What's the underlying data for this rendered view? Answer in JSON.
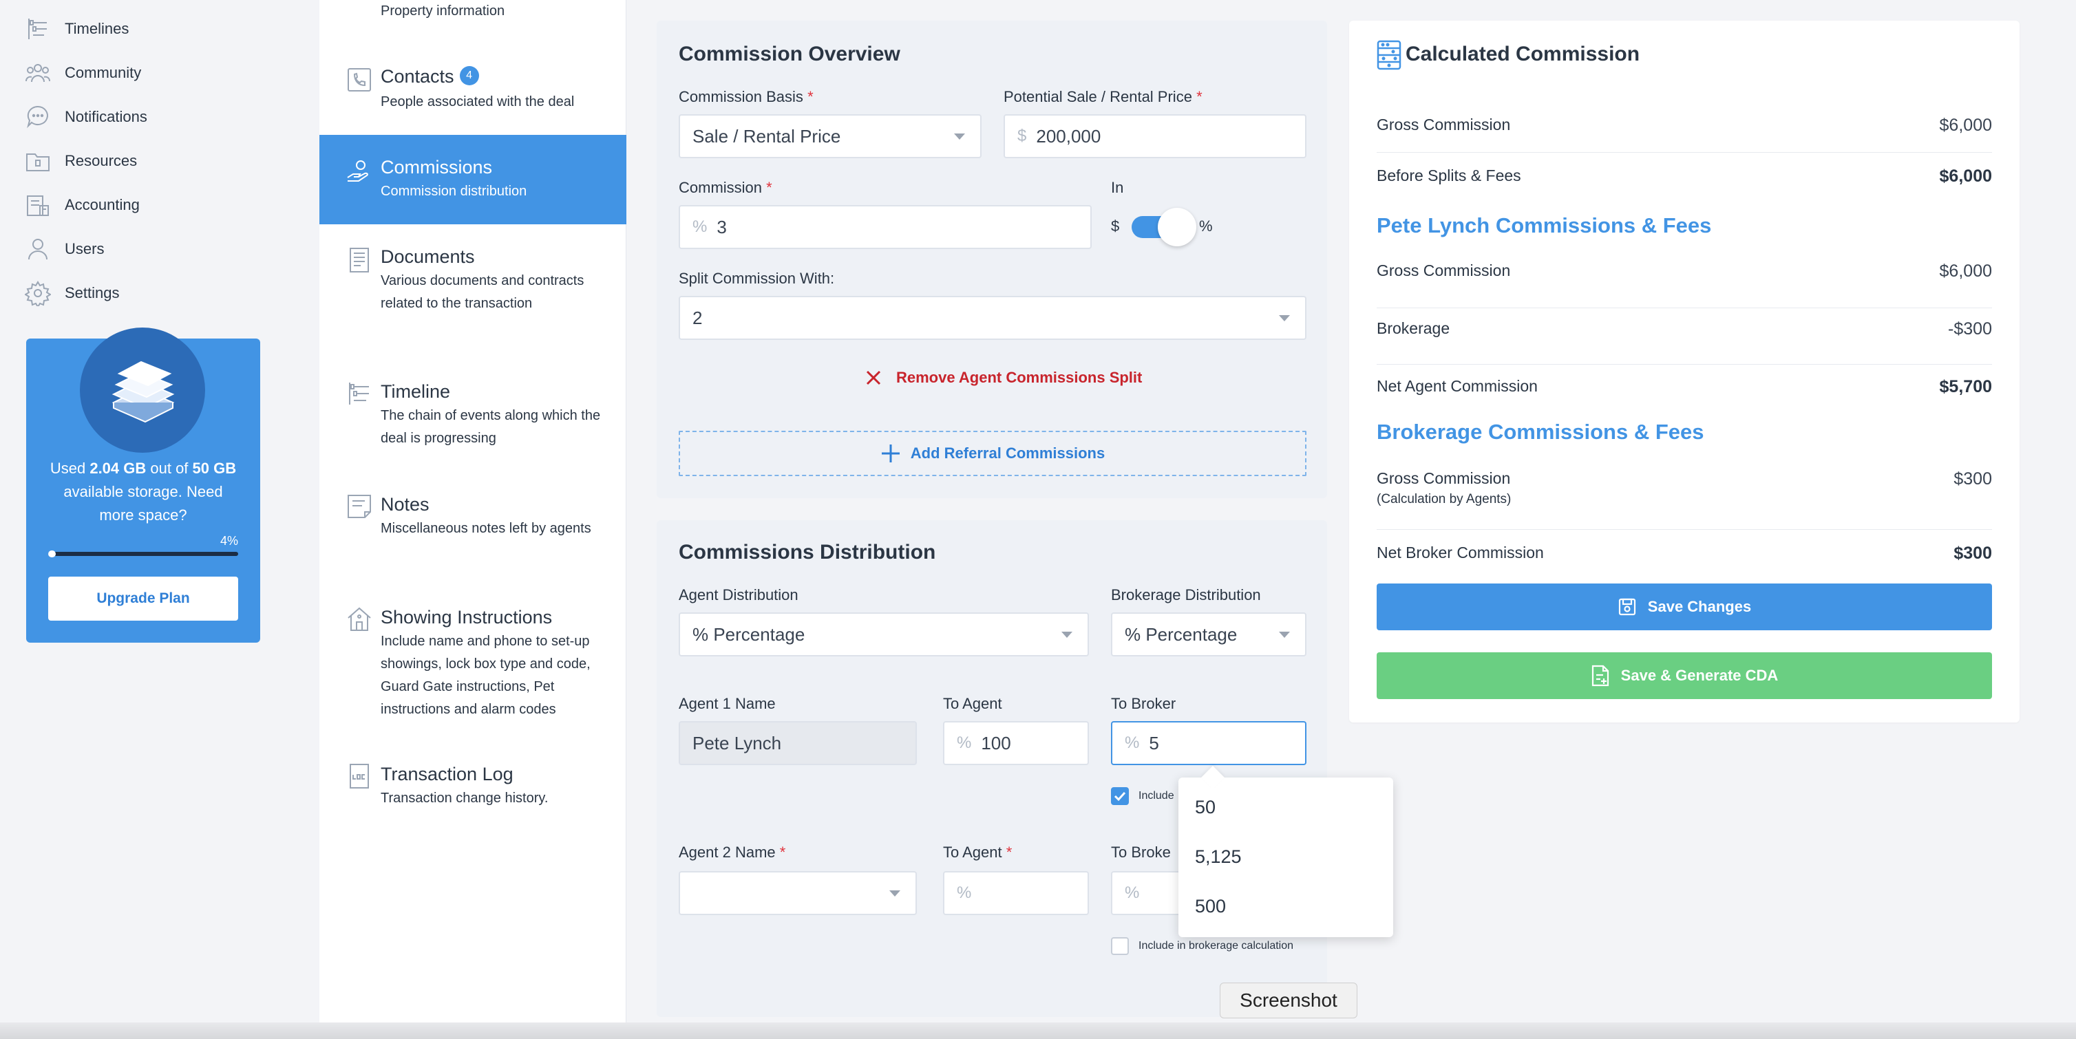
{
  "nav": {
    "items": [
      {
        "label": "Timelines",
        "icon": "timelines-icon"
      },
      {
        "label": "Community",
        "icon": "community-icon"
      },
      {
        "label": "Notifications",
        "icon": "notifications-icon"
      },
      {
        "label": "Resources",
        "icon": "resources-icon"
      },
      {
        "label": "Accounting",
        "icon": "accounting-icon"
      },
      {
        "label": "Users",
        "icon": "users-icon"
      },
      {
        "label": "Settings",
        "icon": "settings-icon"
      }
    ]
  },
  "storage": {
    "text_prefix": "Used ",
    "used": "2.04 GB",
    "text_mid": " out of ",
    "total": "50 GB",
    "text_suffix": " available storage. Need more space?",
    "percent_label": "4%",
    "percent": 4,
    "upgrade_label": "Upgrade Plan"
  },
  "sections": {
    "property_desc": "Property information",
    "contacts_title": "Contacts",
    "contacts_badge": "4",
    "contacts_desc": "People associated with the deal",
    "commissions_title": "Commissions",
    "commissions_desc": "Commission distribution",
    "documents_title": "Documents",
    "documents_desc": "Various documents and contracts related to the transaction",
    "timeline_title": "Timeline",
    "timeline_desc": "The chain of events along which the deal is progressing",
    "notes_title": "Notes",
    "notes_desc": "Miscellaneous notes left by agents",
    "showing_title": "Showing Instructions",
    "showing_desc": "Include name and phone to set-up showings, lock box type and code, Guard Gate instructions, Pet instructions and alarm codes",
    "log_title": "Transaction Log",
    "log_desc": "Transaction change history."
  },
  "overview": {
    "title": "Commission Overview",
    "basis_label": "Commission Basis",
    "basis_value": "Sale / Rental Price",
    "price_label": "Potential Sale / Rental Price",
    "price_prefix": "$",
    "price_value": "200,000",
    "commission_label": "Commission",
    "commission_prefix": "%",
    "commission_value": "3",
    "in_label": "In",
    "toggle_left": "$",
    "toggle_right": "%",
    "split_label": "Split Commission With:",
    "split_value": "2",
    "remove_label": "Remove Agent Commissions Split",
    "add_referral_label": "Add Referral Commissions"
  },
  "distribution": {
    "title": "Commissions Distribution",
    "agent_dist_label": "Agent Distribution",
    "agent_dist_value": "% Percentage",
    "broker_dist_label": "Brokerage Distribution",
    "broker_dist_value": "% Percentage",
    "agent1_label": "Agent 1 Name",
    "agent1_value": "Pete Lynch",
    "to_agent_label": "To Agent",
    "to_agent1_prefix": "%",
    "to_agent1_value": "100",
    "to_broker_label": "To Broker",
    "to_broker1_prefix": "%",
    "to_broker1_value": "5",
    "include_label_short": "Include",
    "agent2_label": "Agent 2 Name",
    "to_agent2_label": "To Agent",
    "to_agent2_prefix": "%",
    "to_broker2_label": "To Broke",
    "to_broker2_prefix": "%",
    "include_label": "Include in brokerage calculation"
  },
  "summary": {
    "title": "Calculated Commission",
    "gross_label": "Gross Commission",
    "gross_value": "$6,000",
    "before_label": "Before Splits & Fees",
    "before_value": "$6,000",
    "pete_heading": "Pete Lynch Commissions & Fees",
    "pete_gross_label": "Gross Commission",
    "pete_gross_value": "$6,000",
    "brokerage_label": "Brokerage",
    "brokerage_value": "-$300",
    "net_agent_label": "Net Agent Commission",
    "net_agent_value": "$5,700",
    "broker_heading": "Brokerage Commissions & Fees",
    "broker_gross_label": "Gross Commission",
    "broker_gross_note": "(Calculation by Agents)",
    "broker_gross_value": "$300",
    "net_broker_label": "Net Broker Commission",
    "net_broker_value": "$300",
    "save_label": "Save Changes",
    "save_cda_label": "Save & Generate CDA"
  },
  "popup": {
    "options": [
      "50",
      "5,125",
      "500"
    ]
  },
  "tooltip": "Screenshot",
  "colors": {
    "accent": "#4294e4",
    "success": "#6acf82",
    "danger": "#c8242c"
  }
}
